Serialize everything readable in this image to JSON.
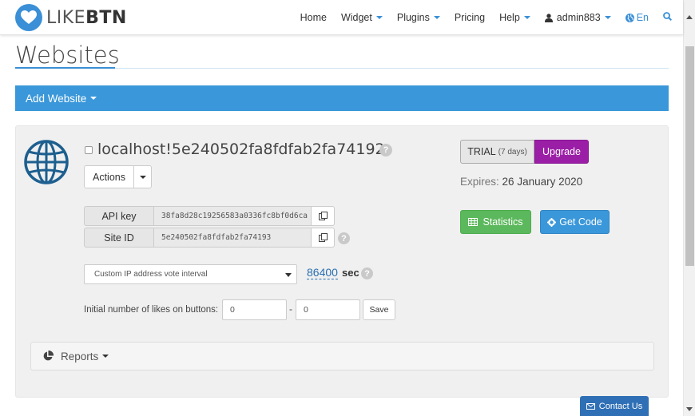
{
  "brand": {
    "logo_text_light": "LIKE",
    "logo_text_bold": "BTN"
  },
  "nav": {
    "items": [
      {
        "label": "Home",
        "dropdown": false
      },
      {
        "label": "Widget",
        "dropdown": true
      },
      {
        "label": "Plugins",
        "dropdown": true
      },
      {
        "label": "Pricing",
        "dropdown": false
      },
      {
        "label": "Help",
        "dropdown": true
      }
    ],
    "user": "admin883",
    "language": "En"
  },
  "page": {
    "title": "Websites",
    "add_website_label": "Add Website"
  },
  "website": {
    "name": "localhost!5e240502fa8fdfab2fa74192",
    "actions_label": "Actions",
    "api_key_label": "API key",
    "api_key_value": "38fa8d28c19256583a0336fc8bf0d6ca",
    "site_id_label": "Site ID",
    "site_id_value": "5e240502fa8fdfab2fa74193",
    "interval_option": "Custom IP address vote interval",
    "interval_value": "86400",
    "interval_unit": "sec",
    "initial_likes_label": "Initial number of likes on buttons:",
    "likes_value_1": "0",
    "likes_separator": "-",
    "likes_value_2": "0",
    "save_label": "Save",
    "plan_label": "TRIAL",
    "plan_days": "(7 days)",
    "upgrade_label": "Upgrade",
    "expires_label": "Expires:",
    "expires_date": "26 January 2020",
    "statistics_label": "Statistics",
    "get_code_label": "Get Code",
    "reports_label": "Reports"
  },
  "contact_label": "Contact Us",
  "colors": {
    "accent": "#3a97d9",
    "upgrade": "#9b1fa6",
    "statistics": "#5cb85c",
    "contact": "#2f6fb5"
  }
}
